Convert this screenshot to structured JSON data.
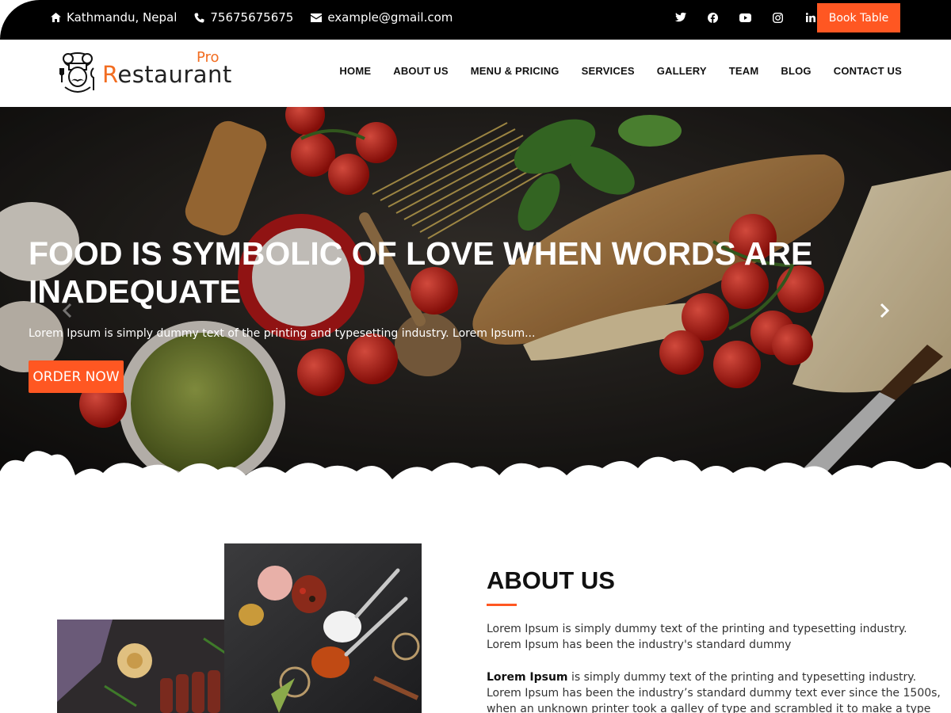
{
  "topbar": {
    "address": "Kathmandu, Nepal",
    "phone": "75675675675",
    "email": "example@gmail.com",
    "social": [
      "twitter-icon",
      "facebook-icon",
      "youtube-icon",
      "instagram-icon",
      "linkedin-icon"
    ],
    "book_label": "Book Table"
  },
  "logo": {
    "first_letter": "R",
    "rest": "estaurant",
    "pro": "Pro"
  },
  "nav": {
    "items": [
      "HOME",
      "ABOUT US",
      "MENU & PRICING",
      "SERVICES",
      "GALLERY",
      "TEAM",
      "BLOG",
      "CONTACT US"
    ]
  },
  "hero": {
    "title": "FOOD IS SYMBOLIC OF LOVE WHEN WORDS ARE INADEQUATE",
    "subtitle": "Lorem Ipsum is simply dummy text of the printing and typesetting industry. Lorem Ipsum...",
    "cta": "ORDER NOW"
  },
  "about": {
    "title": "ABOUT US",
    "p1": "Lorem Ipsum is simply dummy text of the printing and typesetting industry. Lorem Ipsum has been the industry's standard dummy",
    "p2_bold": "Lorem Ipsum",
    "p2_rest": " is simply dummy text of the printing and typesetting industry. Lorem Ipsum has been the industry’s standard dummy text ever since the 1500s, when an unknown printer took a galley of type and scrambled it to make a type specimen book. It has survived not only"
  },
  "colors": {
    "accent": "#ff5722",
    "logo_orange": "#f26d21",
    "topbar": "#000000"
  }
}
